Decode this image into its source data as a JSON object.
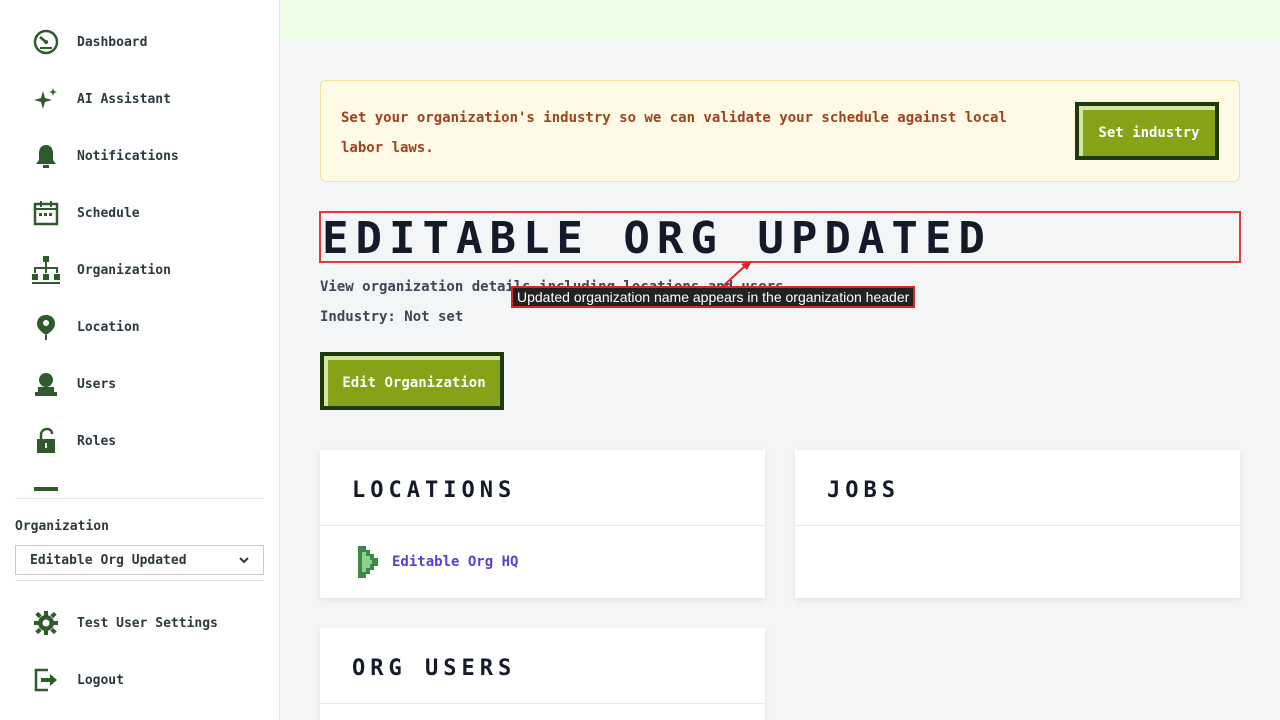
{
  "sidebar": {
    "items": [
      {
        "label": "Dashboard",
        "icon": "dashboard-icon"
      },
      {
        "label": "AI Assistant",
        "icon": "sparkle-icon"
      },
      {
        "label": "Notifications",
        "icon": "bell-icon"
      },
      {
        "label": "Schedule",
        "icon": "calendar-icon"
      },
      {
        "label": "Organization",
        "icon": "org-chart-icon"
      },
      {
        "label": "Location",
        "icon": "map-pin-icon"
      },
      {
        "label": "Users",
        "icon": "user-icon"
      },
      {
        "label": "Roles",
        "icon": "lock-icon"
      }
    ],
    "org_label": "Organization",
    "org_selected": "Editable Org Updated",
    "settings_label": "Test User Settings",
    "logout_label": "Logout"
  },
  "alert": {
    "text": "Set your organization's industry so we can validate your schedule against local labor laws.",
    "button_label": "Set industry"
  },
  "page": {
    "title": "EDITABLE ORG UPDATED",
    "description": "View organization details including locations and users.",
    "industry": "Industry: Not set",
    "edit_button": "Edit Organization"
  },
  "annotation": "Updated organization name appears in the organization header",
  "cards": {
    "locations_title": "LOCATIONS",
    "location_item": "Editable Org HQ",
    "jobs_title": "JOBS",
    "org_users_title": "ORG USERS"
  },
  "colors": {
    "accent": "#86a318",
    "accent_dark": "#1e3a0c",
    "icon": "#2f5a2a",
    "link": "#5a3fd0",
    "alert_text": "#a0421b",
    "annotation_border": "#e23a3a"
  }
}
